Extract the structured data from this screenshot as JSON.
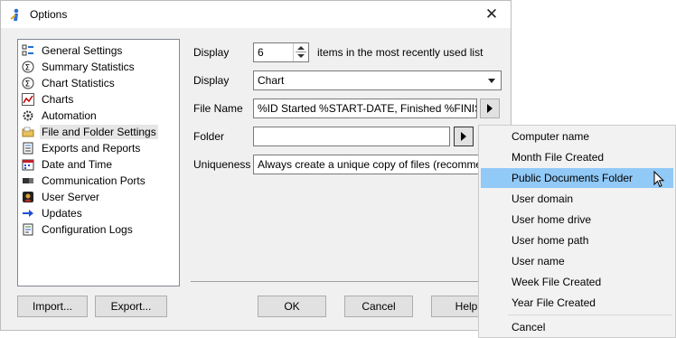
{
  "window": {
    "title": "Options",
    "close_glyph": "✕"
  },
  "tree": {
    "items": [
      {
        "label": "General Settings",
        "icon": "grid-icon"
      },
      {
        "label": "Summary Statistics",
        "icon": "stats-icon"
      },
      {
        "label": "Chart Statistics",
        "icon": "stats-icon"
      },
      {
        "label": "Charts",
        "icon": "chart-line-icon"
      },
      {
        "label": "Automation",
        "icon": "gear-icon"
      },
      {
        "label": "File and Folder Settings",
        "icon": "folder-icon",
        "selected": true
      },
      {
        "label": "Exports and Reports",
        "icon": "report-icon"
      },
      {
        "label": "Date and Time",
        "icon": "calendar-icon"
      },
      {
        "label": "Communication Ports",
        "icon": "port-icon"
      },
      {
        "label": "User Server",
        "icon": "server-icon"
      },
      {
        "label": "Updates",
        "icon": "arrow-right-icon"
      },
      {
        "label": "Configuration Logs",
        "icon": "log-icon"
      }
    ]
  },
  "form": {
    "display_label": "Display",
    "display_count": "6",
    "display_suffix": "items in the most recently used list",
    "display2_label": "Display",
    "display2_value": "Chart",
    "filename_label": "File Name",
    "filename_value": "%ID Started %START-DATE, Finished %FINISH-",
    "folder_label": "Folder",
    "folder_value": "",
    "uniqueness_label": "Uniqueness",
    "uniqueness_value": "Always create a unique copy of files (recommende"
  },
  "buttons": {
    "import": "Import...",
    "export": "Export...",
    "ok": "OK",
    "cancel": "Cancel",
    "help": "Help"
  },
  "menu": {
    "items": [
      "Computer name",
      "Month File Created",
      "Public Documents Folder",
      "User domain",
      "User home drive",
      "User home path",
      "User name",
      "Week File Created",
      "Year File Created"
    ],
    "hover_index": 2,
    "cancel": "Cancel"
  },
  "colors": {
    "menu_hover": "#91c9f7",
    "updates_arrow": "#1f4fd6"
  }
}
